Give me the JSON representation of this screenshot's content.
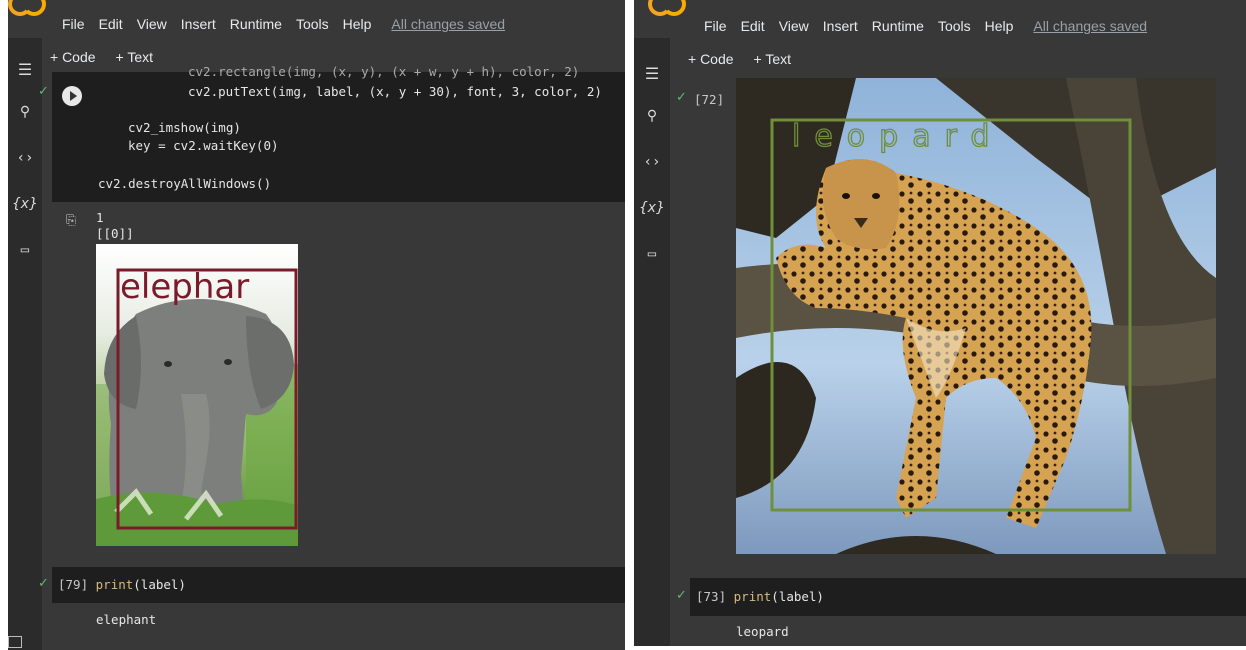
{
  "left": {
    "menu": [
      "File",
      "Edit",
      "View",
      "Insert",
      "Runtime",
      "Tools",
      "Help"
    ],
    "saved": "All changes saved",
    "toolbar": {
      "code": "+ Code",
      "text": "+ Text"
    },
    "sidebar_icons": [
      "menu-icon",
      "search-icon",
      "code-icon",
      "variables-icon",
      "folder-icon"
    ],
    "code_lines": {
      "l0": "cv2.rectangle(img, (x, y), (x + w, y + h), color, 2)",
      "l1": "cv2.putText(img, label, (x, y + 30), font, 3, color, 2)",
      "l2": "cv2_imshow(img)",
      "l3": "key = cv2.waitKey(0)",
      "l4": "cv2.destroyAllWindows()"
    },
    "output": {
      "line1": "1",
      "line2": "[[0]]",
      "image_label": "elephar"
    },
    "print_cell": {
      "exec": "[79]",
      "code_fn": "print",
      "code_arg": "(label)"
    },
    "print_output": "elephant",
    "box_color": "#7a1a2a"
  },
  "right": {
    "menu": [
      "File",
      "Edit",
      "View",
      "Insert",
      "Runtime",
      "Tools",
      "Help"
    ],
    "saved": "All changes saved",
    "toolbar": {
      "code": "+ Code",
      "text": "+ Text"
    },
    "sidebar_icons": [
      "menu-icon",
      "search-icon",
      "code-icon",
      "variables-icon",
      "folder-icon"
    ],
    "image_cell_exec": "[72]",
    "image_label": "leopard",
    "print_cell": {
      "exec": "[73]",
      "code_fn": "print",
      "code_arg": "(label)"
    },
    "print_output": "leopard",
    "box_color": "#6f8f3a"
  }
}
